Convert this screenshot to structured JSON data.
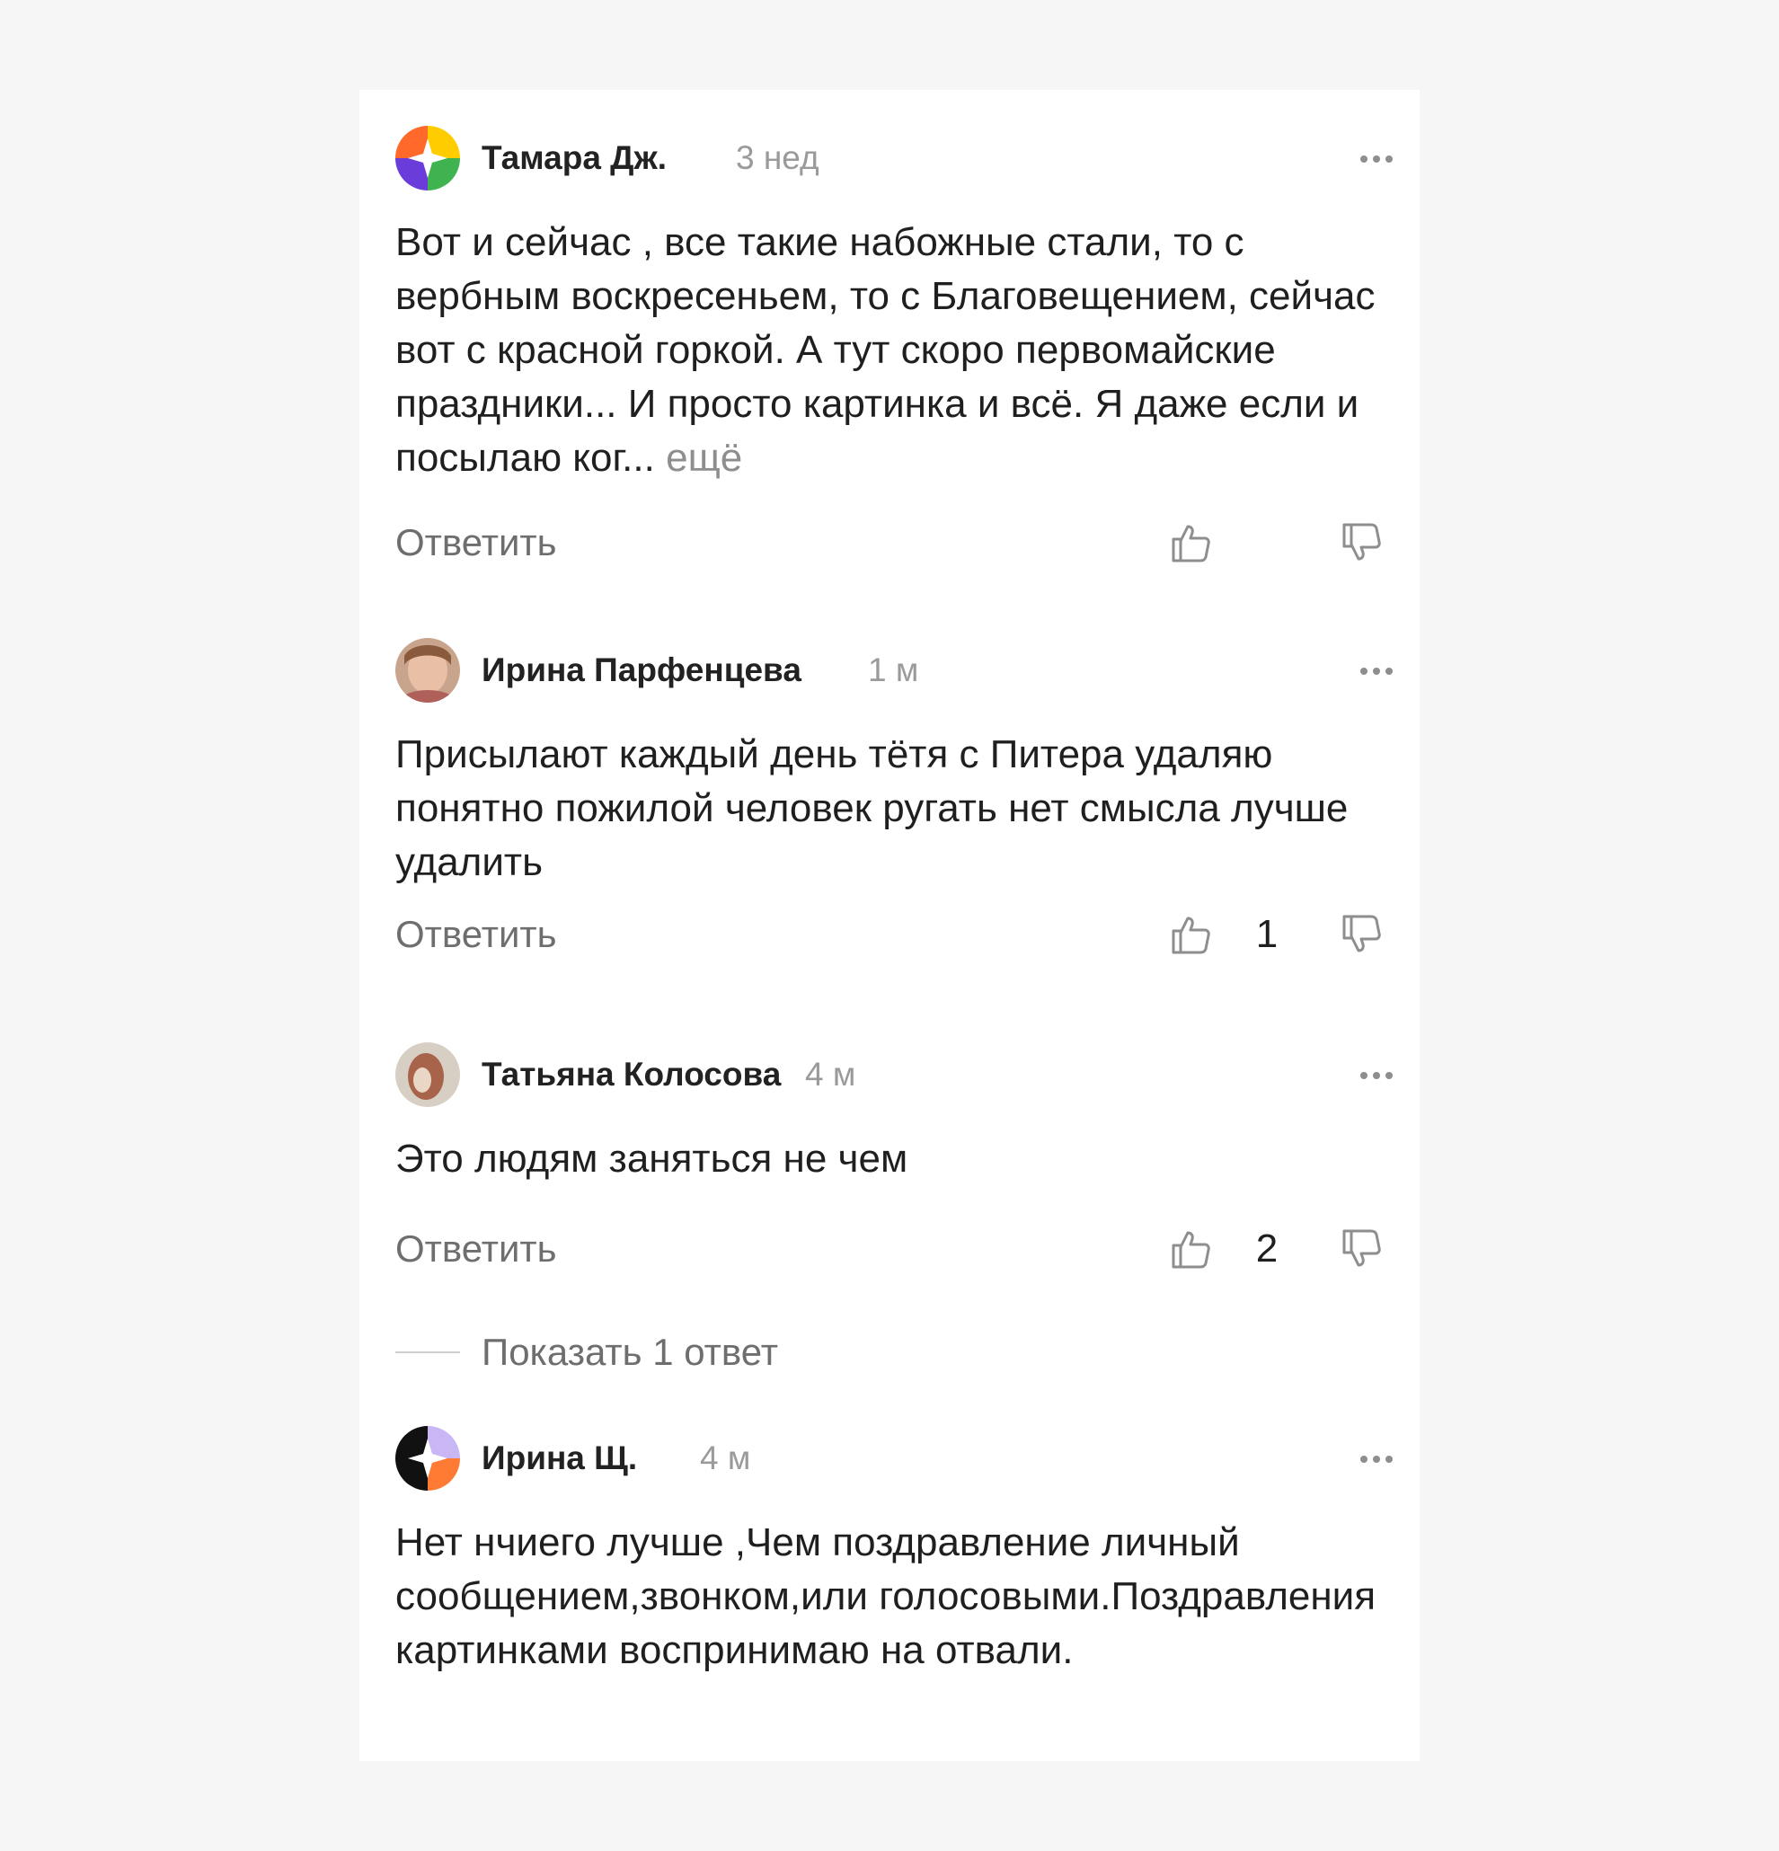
{
  "comments": [
    {
      "author": "Тамара Дж.",
      "time": "3 нед",
      "text": "Вот и сейчас , все такие набожные стали, то с вербным воскресеньем, то с Благовещением, сейчас вот с красной горкой. А тут скоро первомайские праздники... И просто картинка и всё. Я даже если и посылаю ког...",
      "more_label": "ещё",
      "reply_label": "Ответить",
      "likes": "",
      "avatar_icon": "colorful-burst-avatar-icon"
    },
    {
      "author": "Ирина Парфенцева",
      "time": "1 м",
      "text": "Присылают каждый день тётя с Питера удаляю понятно пожилой человек ругать нет смысла лучше удалить",
      "reply_label": "Ответить",
      "likes": "1",
      "avatar_icon": "user-photo-avatar"
    },
    {
      "author": "Татьяна Колосова",
      "time": "4 м",
      "text": "Это людям заняться не чем",
      "reply_label": "Ответить",
      "likes": "2",
      "avatar_icon": "user-photo-avatar"
    },
    {
      "author": "Ирина Щ.",
      "time": "4 м",
      "text": "Нет нчиего лучше ,Чем поздравление личный сообщением,звонком,или голосовыми.Поздравления картинками воспринимаю на отвали.",
      "avatar_icon": "colorful-burst-avatar-icon"
    }
  ],
  "show_replies_label": "Показать 1 ответ",
  "icons": {
    "like": "thumbs-up-icon",
    "dislike": "thumbs-down-icon",
    "more": "more-dots-icon"
  },
  "colors": {
    "background": "#f6f6f6",
    "card": "#ffffff",
    "text": "#1f1f1f",
    "muted": "#8e8e8e",
    "secondary": "#6e6e6e"
  }
}
